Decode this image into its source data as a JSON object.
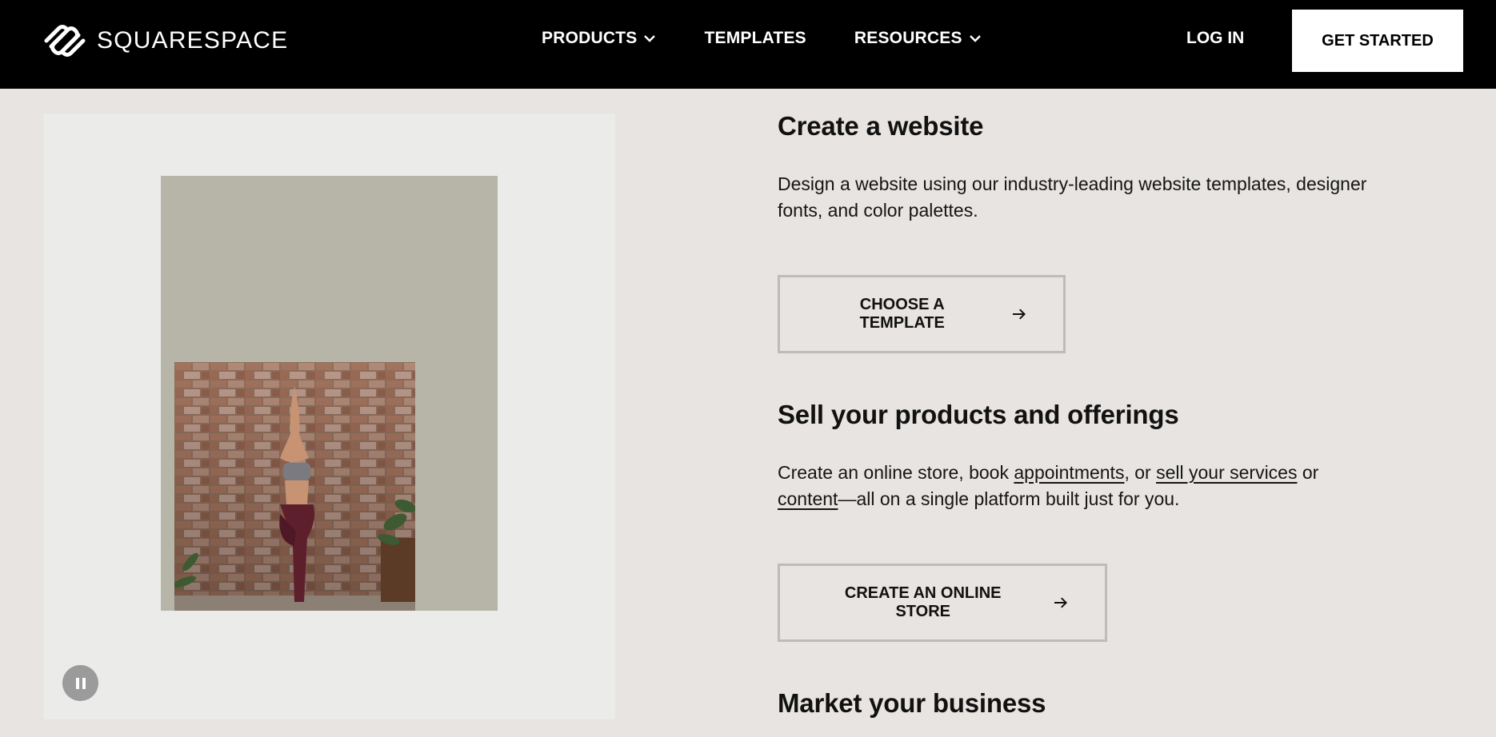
{
  "header": {
    "logo_text": "SQUARESPACE",
    "nav": [
      {
        "label": "PRODUCTS",
        "has_dropdown": true
      },
      {
        "label": "TEMPLATES",
        "has_dropdown": false
      },
      {
        "label": "RESOURCES",
        "has_dropdown": true
      }
    ],
    "login_label": "LOG IN",
    "cta_label": "GET STARTED"
  },
  "media": {
    "pause_icon": "pause-icon",
    "panel_color": "#ebebea",
    "card_color": "#b6b5a8"
  },
  "sections": [
    {
      "title": "Create a website",
      "description": "Design a website using our industry-leading website templates, designer fonts, and color palettes.",
      "cta_label": "CHOOSE A TEMPLATE"
    },
    {
      "title": "Sell your products and offerings",
      "description_parts": {
        "p1": "Create an online store, book ",
        "link1": "appointments",
        "p2": ", or ",
        "link2": "sell your services",
        "p3": " or ",
        "link3": "content",
        "p4": "—all on a single platform built just for you."
      },
      "cta_label": "CREATE AN ONLINE STORE"
    },
    {
      "title": "Market your business"
    }
  ],
  "colors": {
    "header_bg": "#000000",
    "page_bg": "#e7e4e1",
    "button_border": "#bcbcbc"
  }
}
